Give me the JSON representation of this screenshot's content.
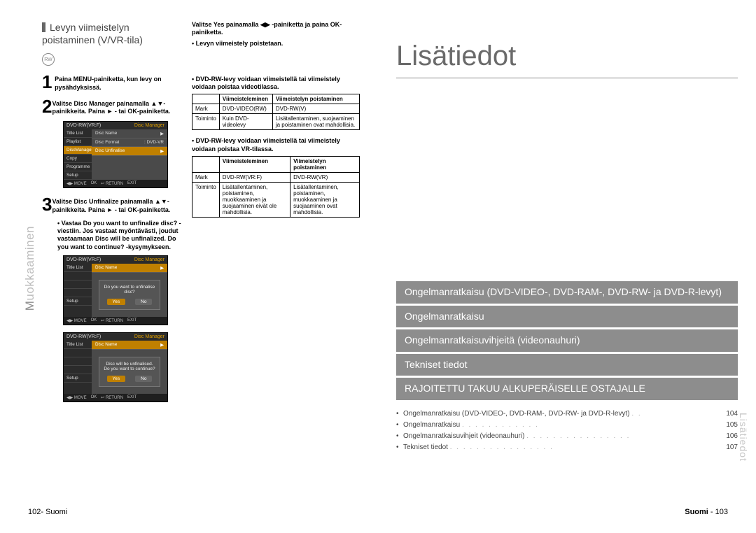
{
  "left": {
    "vlabel_prefix": "M",
    "vlabel_rest": "uokkaaminen",
    "section_title": "Levyn viimeistelyn poistaminen (V/VR-tila)",
    "step1": "Paina MENU-painiketta, kun levy on pysähdyksissä.",
    "step2": "Valitse Disc Manager painamalla ▲▼-painikkeita. Paina ► - tai OK-painiketta.",
    "step3": "Valitse Disc Unfinalize painamalla ▲▼-painikkeita. Paina ► - tai OK-painiketta.",
    "step3b": "Vastaa Do you want to unfinalize disc? -viestiin. Jos vastaat myöntävästi, joudut vastaamaan Disc will be unfinalized. Do you want to continue? -kysymykseen.",
    "menushot_title": "DVD-RW(VR:F)",
    "menushot_corner": "Disc Manager",
    "side_items": [
      "Title List",
      "Playlist",
      "DiscManager",
      "Copy",
      "Programme",
      "Setup"
    ],
    "panel_rows": [
      [
        "Disc Name",
        ":",
        "▶"
      ],
      [
        "Disc Format",
        ": DVD-VR",
        "▶"
      ],
      [
        "Disc Unfinalise",
        "",
        "▶"
      ]
    ],
    "foot": [
      "◀▶ MOVE",
      "OK",
      "↩ RETURN",
      "EXIT"
    ],
    "dialog1": "Do you want to unfinalise disc?",
    "dialog2a": "Disc will be unfinalised.",
    "dialog2b": "Do you want to continue?",
    "yes": "Yes",
    "no": "No",
    "colB_top1": "Valitse Yes painamalla ◀▶ -painiketta ja paina OK-painiketta.",
    "colB_top2": "• Levyn viimeistely poistetaan.",
    "note1": "• DVD-RW-levy voidaan viimeistellä tai viimeistely voidaan poistaa videotilassa.",
    "note2": "• DVD-RW-levy voidaan viimeistellä tai viimeistely voidaan poistaa VR-tilassa.",
    "tab1": {
      "h1": "",
      "h2": "Viimeisteleminen",
      "h3": "Viimeistelyn poistaminen",
      "r1": [
        "Mark",
        "DVD-VIDEO(RW)",
        "DVD-RW(V)"
      ],
      "r2": [
        "Toiminto",
        "Kuin DVD-videolevy",
        "Lisätallentaminen, suojaaminen ja poistaminen ovat mahdollisia."
      ]
    },
    "tab2": {
      "h1": "",
      "h2": "Viimeisteleminen",
      "h3": "Viimeistelyn poistaminen",
      "r1": [
        "Mark",
        "DVD-RW(VR:F)",
        "DVD-RW(VR)"
      ],
      "r2": [
        "Toiminto",
        "Lisätallentaminen, poistaminen, muokkaaminen ja suojaaminen eivät ole mahdollisia.",
        "Lisätallentaminen, poistaminen, muokkaaminen ja suojaaminen ovat mahdollisia."
      ]
    },
    "footer_l": "102- Suomi"
  },
  "right": {
    "title": "Lisätiedot",
    "sections": [
      "Ongelmanratkaisu (DVD-VIDEO-, DVD-RAM-, DVD-RW- ja DVD-R-levyt)",
      "Ongelmanratkaisu",
      "Ongelmanratkaisuvihjeitä (videonauhuri)",
      "Tekniset tiedot",
      "RAJOITETTU TAKUU ALKUPERÄISELLE OSTAJALLE"
    ],
    "toc": [
      {
        "label": "Ongelmanratkaisu (DVD-VIDEO-, DVD-RAM-, DVD-RW- ja DVD-R-levyt)",
        "dots": ". .",
        "page": "104"
      },
      {
        "label": "Ongelmanratkaisu",
        "dots": ". . . . . . . . . . . .",
        "page": "105"
      },
      {
        "label": "Ongelmanratkaisuvihjeit (videonauhuri)",
        "dots": ". . . . . . . . . . . . . . . .",
        "page": "106"
      },
      {
        "label": "Tekniset tiedot",
        "dots": ". . . . . . . . . . . . . . . .",
        "page": "107"
      }
    ],
    "sidevert": "Lisätiedot",
    "footer_r": "Suomi - 103"
  }
}
